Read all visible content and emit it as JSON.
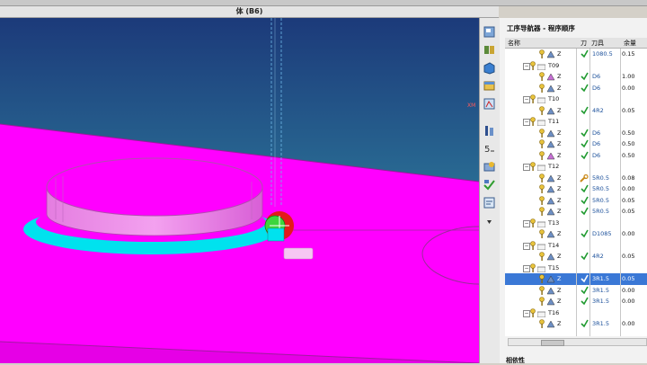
{
  "window": {
    "title": "体 (B6)"
  },
  "viewport": {
    "axis_label": "XM",
    "colors": {
      "sky_top": "#1c3a7a",
      "sky_bottom": "#25628f",
      "surface": "#ff00ff",
      "ring": "#00e5f0",
      "tool": "#e31b1b"
    }
  },
  "navigator": {
    "title": "工序导航器 - 程序顺序",
    "columns": {
      "name": "名称",
      "path": "刀",
      "tool": "刀具",
      "stock": "余量"
    },
    "rows": [
      {
        "name": "Z",
        "tool": "1080.5",
        "stock": "0.15",
        "check": true,
        "indent": 3,
        "kind": "op",
        "expander": ""
      },
      {
        "name": "T09",
        "tool": "",
        "stock": "",
        "check": false,
        "indent": 2,
        "kind": "group",
        "expander": "−"
      },
      {
        "name": "Z",
        "tool": "D6",
        "stock": "1.00",
        "check": true,
        "indent": 3,
        "kind": "op2",
        "expander": ""
      },
      {
        "name": "Z",
        "tool": "D6",
        "stock": "0.00",
        "check": true,
        "indent": 3,
        "kind": "op",
        "expander": ""
      },
      {
        "name": "T10",
        "tool": "",
        "stock": "",
        "check": false,
        "indent": 2,
        "kind": "group",
        "expander": "−"
      },
      {
        "name": "Z",
        "tool": "4R2",
        "stock": "0.05",
        "check": true,
        "indent": 3,
        "kind": "op",
        "expander": ""
      },
      {
        "name": "T11",
        "tool": "",
        "stock": "",
        "check": false,
        "indent": 2,
        "kind": "group",
        "expander": "−"
      },
      {
        "name": "Z",
        "tool": "D6",
        "stock": "0.50",
        "check": true,
        "indent": 3,
        "kind": "op",
        "expander": ""
      },
      {
        "name": "Z",
        "tool": "D6",
        "stock": "0.50",
        "check": true,
        "indent": 3,
        "kind": "op",
        "expander": ""
      },
      {
        "name": "Z",
        "tool": "D6",
        "stock": "0.50",
        "check": true,
        "indent": 3,
        "kind": "op2",
        "expander": ""
      },
      {
        "name": "T12",
        "tool": "",
        "stock": "",
        "check": false,
        "indent": 2,
        "kind": "group",
        "expander": "−"
      },
      {
        "name": "Z",
        "tool": "5R0.5",
        "stock": "0.08",
        "check": false,
        "wrench": true,
        "indent": 3,
        "kind": "op",
        "expander": ""
      },
      {
        "name": "Z",
        "tool": "5R0.5",
        "stock": "0.00",
        "check": true,
        "indent": 3,
        "kind": "op",
        "expander": ""
      },
      {
        "name": "Z",
        "tool": "5R0.5",
        "stock": "0.05",
        "check": true,
        "indent": 3,
        "kind": "op",
        "expander": ""
      },
      {
        "name": "Z",
        "tool": "5R0.5",
        "stock": "0.05",
        "check": true,
        "indent": 3,
        "kind": "op",
        "expander": ""
      },
      {
        "name": "T13",
        "tool": "",
        "stock": "",
        "check": false,
        "indent": 2,
        "kind": "group",
        "expander": "−"
      },
      {
        "name": "Z",
        "tool": "D1085",
        "stock": "0.00",
        "check": true,
        "indent": 3,
        "kind": "op",
        "expander": ""
      },
      {
        "name": "T14",
        "tool": "",
        "stock": "",
        "check": false,
        "indent": 2,
        "kind": "group",
        "expander": "−"
      },
      {
        "name": "Z",
        "tool": "4R2",
        "stock": "0.05",
        "check": true,
        "indent": 3,
        "kind": "op",
        "expander": ""
      },
      {
        "name": "T15",
        "tool": "",
        "stock": "",
        "check": false,
        "indent": 2,
        "kind": "group",
        "expander": "−"
      },
      {
        "name": "Z",
        "tool": "3R1.5",
        "stock": "0.05",
        "check": true,
        "indent": 3,
        "kind": "op",
        "expander": "",
        "selected": true
      },
      {
        "name": "Z",
        "tool": "3R1.5",
        "stock": "0.00",
        "check": true,
        "indent": 3,
        "kind": "op",
        "expander": ""
      },
      {
        "name": "Z",
        "tool": "3R1.5",
        "stock": "0.00",
        "check": true,
        "indent": 3,
        "kind": "op",
        "expander": ""
      },
      {
        "name": "T16",
        "tool": "",
        "stock": "",
        "check": false,
        "indent": 2,
        "kind": "group",
        "expander": "−"
      },
      {
        "name": "Z",
        "tool": "3R1.5",
        "stock": "0.00",
        "check": true,
        "indent": 3,
        "kind": "op",
        "expander": ""
      }
    ],
    "footer_label": "相依性"
  }
}
